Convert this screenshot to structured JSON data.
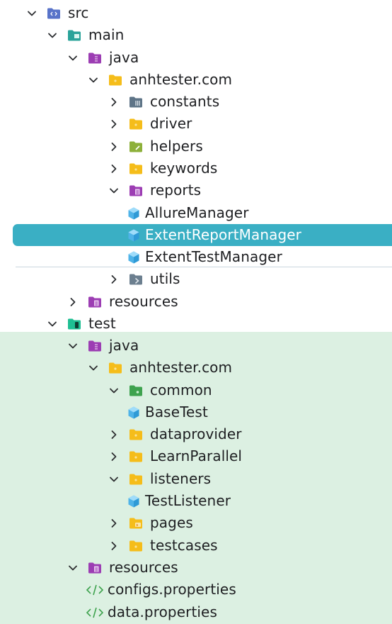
{
  "colors": {
    "selected_bg": "#3aafc4",
    "test_bg": "#dcf0e2",
    "folder": "#f5bd1a",
    "source_folder": "#9c3db3",
    "class_icon": "#4fb3e8"
  },
  "tree": {
    "nodes": [
      {
        "label": "src",
        "icon": "src-folder-icon",
        "expanded": true
      },
      {
        "label": "main",
        "icon": "module-folder-icon",
        "expanded": true
      },
      {
        "label": "java",
        "icon": "source-root-folder-icon",
        "expanded": true
      },
      {
        "label": "anhtester.com",
        "icon": "package-folder-icon",
        "expanded": true
      },
      {
        "label": "constants",
        "icon": "constants-folder-icon",
        "expanded": false
      },
      {
        "label": "driver",
        "icon": "package-folder-icon",
        "expanded": false
      },
      {
        "label": "helpers",
        "icon": "helpers-folder-icon",
        "expanded": false
      },
      {
        "label": "keywords",
        "icon": "package-folder-icon",
        "expanded": false
      },
      {
        "label": "reports",
        "icon": "reports-folder-icon",
        "expanded": true
      },
      {
        "label": "AllureManager",
        "icon": "class-icon"
      },
      {
        "label": "ExtentReportManager",
        "icon": "class-icon",
        "selected": true
      },
      {
        "label": "ExtentTestManager",
        "icon": "class-icon"
      },
      {
        "label": "utils",
        "icon": "utils-folder-icon",
        "expanded": false
      },
      {
        "label": "resources",
        "icon": "resources-folder-icon",
        "expanded": false
      },
      {
        "label": "test",
        "icon": "test-module-folder-icon",
        "expanded": true
      },
      {
        "label": "java",
        "icon": "source-root-folder-icon",
        "expanded": true
      },
      {
        "label": "anhtester.com",
        "icon": "package-folder-icon",
        "expanded": true
      },
      {
        "label": "common",
        "icon": "common-folder-icon",
        "expanded": true
      },
      {
        "label": "BaseTest",
        "icon": "class-icon"
      },
      {
        "label": "dataprovider",
        "icon": "package-folder-icon",
        "expanded": false
      },
      {
        "label": "LearnParallel",
        "icon": "package-folder-icon",
        "expanded": false
      },
      {
        "label": "listeners",
        "icon": "package-folder-icon",
        "expanded": true
      },
      {
        "label": "TestListener",
        "icon": "class-icon"
      },
      {
        "label": "pages",
        "icon": "pages-folder-icon",
        "expanded": false
      },
      {
        "label": "testcases",
        "icon": "package-folder-icon",
        "expanded": false
      },
      {
        "label": "resources",
        "icon": "resources-folder-icon",
        "expanded": true
      },
      {
        "label": "configs.properties",
        "icon": "properties-file-icon"
      },
      {
        "label": "data.properties",
        "icon": "properties-file-icon"
      }
    ]
  }
}
